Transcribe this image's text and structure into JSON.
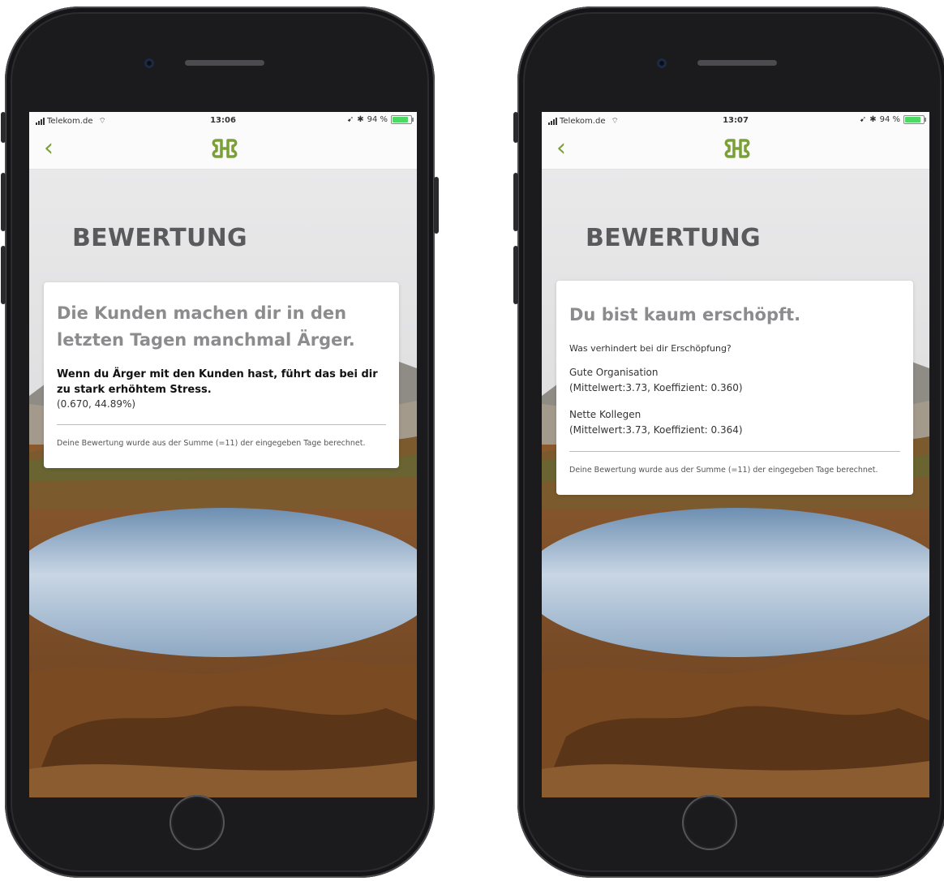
{
  "colors": {
    "accent": "#7ba037",
    "title": "#5a5a5d",
    "headline": "#8c8c8e"
  },
  "phones": [
    {
      "status": {
        "carrier": "Telekom.de",
        "time": "13:06",
        "battery": "94 %",
        "battery_level": 0.94
      },
      "nav": {
        "back_icon": "chevron-left-icon",
        "logo_icon": "app-logo-icon"
      },
      "title": "BEWERTUNG",
      "card": {
        "headline": "Die Kunden machen dir in den letzten Tagen manchmal Ärger.",
        "bold_text": "Wenn du Ärger mit den Kunden hast, führt das bei dir zu stark erhöhtem Stress.",
        "stats": "(0.670, 44.89%)",
        "footnote": "Deine Bewertung wurde aus der Summe (=11) der eingegeben Tage berechnet."
      }
    },
    {
      "status": {
        "carrier": "Telekom.de",
        "time": "13:07",
        "battery": "94 %",
        "battery_level": 0.94
      },
      "nav": {
        "back_icon": "chevron-left-icon",
        "logo_icon": "app-logo-icon"
      },
      "title": "BEWERTUNG",
      "card": {
        "headline": "Du bist kaum erschöpft.",
        "question": "Was verhindert bei dir Erschöpfung?",
        "factors": [
          {
            "name": "Gute Organisation",
            "detail": "(Mittelwert:3.73, Koeffizient: 0.360)"
          },
          {
            "name": "Nette Kollegen",
            "detail": "(Mittelwert:3.73, Koeffizient: 0.364)"
          }
        ],
        "footnote": "Deine Bewertung wurde aus der Summe (=11) der eingegeben Tage berechnet."
      }
    }
  ]
}
